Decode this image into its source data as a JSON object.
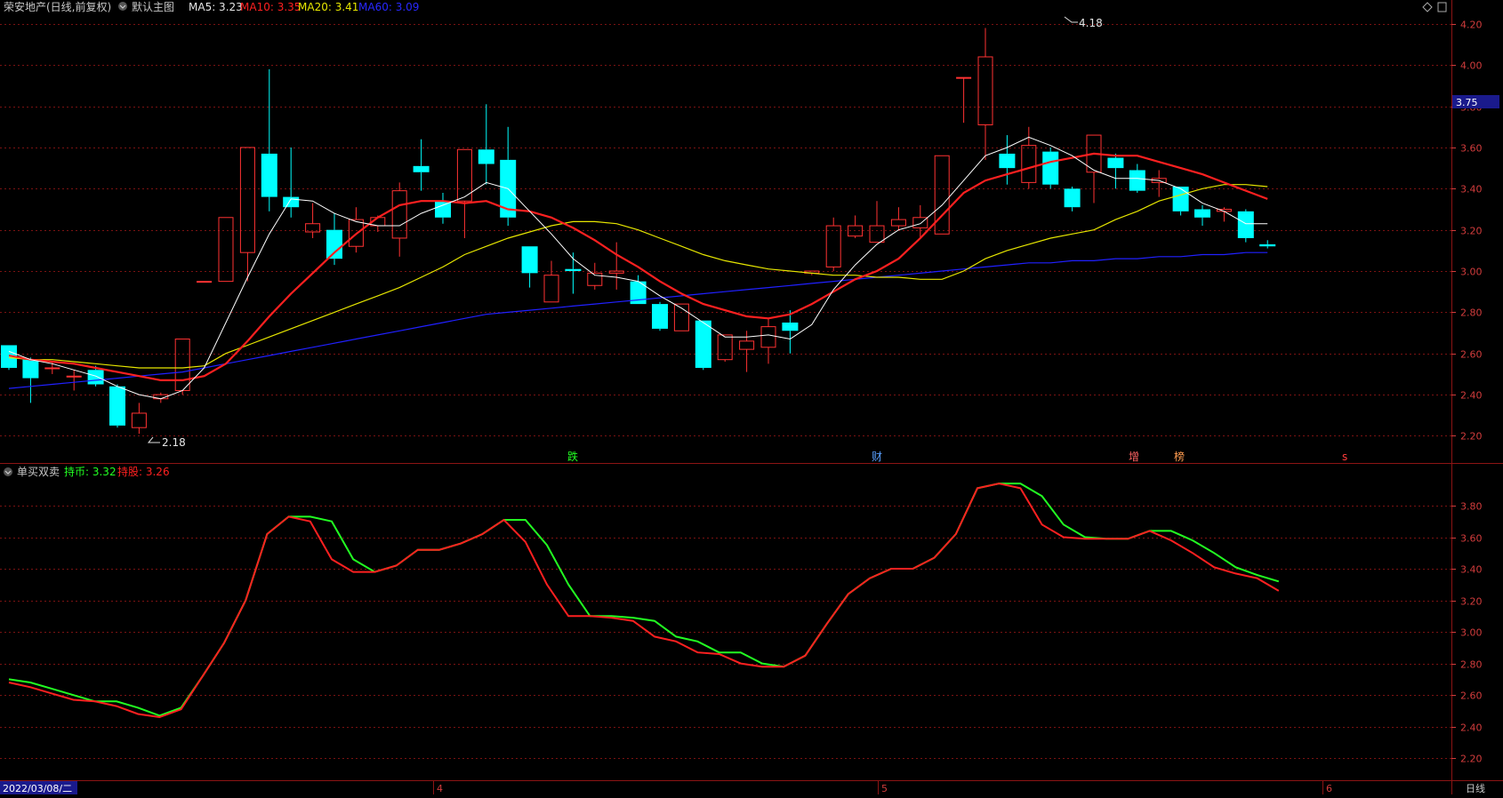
{
  "header": {
    "stock_name": "荣安地产(日线,前复权)",
    "main_indicator": "默认主图",
    "ma5_label": "MA5: 3.23",
    "ma10_label": "MA10: 3.35",
    "ma20_label": "MA20: 3.41",
    "ma60_label": "MA60: 3.09"
  },
  "sub_header": {
    "indicator_name": "单买双卖",
    "hold_coin_label": "持币: 3.32",
    "hold_stock_label": "持股: 3.26"
  },
  "price_badge": "3.75",
  "annotations": {
    "high_label": "4.18",
    "low_label": "2.18",
    "event_die": "跌",
    "event_cai": "财",
    "event_zeng": "增",
    "event_bang": "榜",
    "event_s": "s"
  },
  "bottom_bar": {
    "date_label": "2022/03/08/二",
    "month_4": "4",
    "month_5": "5",
    "month_6": "6",
    "period_label": "日线"
  },
  "colors": {
    "background": "#000000",
    "grid": "#7a1212",
    "up": "#ff3232",
    "down": "#00ffff",
    "ma5": "#ffffff",
    "ma10": "#ff2020",
    "ma20": "#e6e600",
    "ma60": "#2020ff",
    "hold_coin": "#22ff22",
    "hold_stock": "#ff2020",
    "axis_text": "#d23c3c",
    "badge": "#1a1a8c"
  },
  "chart_data": [
    {
      "type": "candlestick",
      "y_ticks": [
        2.2,
        2.4,
        2.6,
        2.8,
        3.0,
        3.2,
        3.4,
        3.6,
        3.8,
        4.0,
        4.2
      ],
      "ylim": [
        2.12,
        4.26
      ],
      "grid": true,
      "candles": [
        [
          2.64,
          2.53,
          2.64,
          2.52
        ],
        [
          2.57,
          2.48,
          2.58,
          2.36
        ],
        [
          2.53,
          2.53,
          2.56,
          2.5
        ],
        [
          2.49,
          2.49,
          2.52,
          2.42
        ],
        [
          2.52,
          2.45,
          2.54,
          2.44
        ],
        [
          2.44,
          2.25,
          2.45,
          2.24
        ],
        [
          2.24,
          2.31,
          2.36,
          2.21
        ],
        [
          2.38,
          2.4,
          2.41,
          2.36
        ],
        [
          2.42,
          2.67,
          2.67,
          2.4
        ],
        [
          2.95,
          2.95,
          2.95,
          2.95
        ],
        [
          2.95,
          3.26,
          3.26,
          2.95
        ],
        [
          3.09,
          3.6,
          3.6,
          2.95
        ],
        [
          3.57,
          3.36,
          3.98,
          3.29
        ],
        [
          3.36,
          3.31,
          3.6,
          3.26
        ],
        [
          3.19,
          3.23,
          3.33,
          3.16
        ],
        [
          3.2,
          3.06,
          3.28,
          3.03
        ],
        [
          3.12,
          3.25,
          3.31,
          3.09
        ],
        [
          3.22,
          3.26,
          3.27,
          3.19
        ],
        [
          3.16,
          3.39,
          3.43,
          3.07
        ],
        [
          3.51,
          3.48,
          3.64,
          3.39
        ],
        [
          3.34,
          3.26,
          3.38,
          3.23
        ],
        [
          3.34,
          3.59,
          3.59,
          3.16
        ],
        [
          3.59,
          3.52,
          3.81,
          3.42
        ],
        [
          3.54,
          3.26,
          3.7,
          3.22
        ],
        [
          3.12,
          2.99,
          3.12,
          2.92
        ],
        [
          2.85,
          2.98,
          3.05,
          2.85
        ],
        [
          3.01,
          3.0,
          3.09,
          2.89
        ],
        [
          2.93,
          2.99,
          3.04,
          2.91
        ],
        [
          2.99,
          3.0,
          3.14,
          2.91
        ],
        [
          2.95,
          2.84,
          2.98,
          2.84
        ],
        [
          2.84,
          2.72,
          2.85,
          2.71
        ],
        [
          2.71,
          2.84,
          2.84,
          2.71
        ],
        [
          2.76,
          2.53,
          2.76,
          2.52
        ],
        [
          2.57,
          2.69,
          2.69,
          2.56
        ],
        [
          2.62,
          2.66,
          2.71,
          2.51
        ],
        [
          2.63,
          2.73,
          2.77,
          2.55
        ],
        [
          2.75,
          2.71,
          2.81,
          2.6
        ],
        [
          2.99,
          3.0,
          3.0,
          2.98
        ],
        [
          3.02,
          3.22,
          3.26,
          3.0
        ],
        [
          3.17,
          3.22,
          3.27,
          3.16
        ],
        [
          3.14,
          3.22,
          3.34,
          3.14
        ],
        [
          3.22,
          3.25,
          3.31,
          3.2
        ],
        [
          3.21,
          3.26,
          3.32,
          3.16
        ],
        [
          3.18,
          3.56,
          3.56,
          3.18
        ],
        [
          3.94,
          3.94,
          3.94,
          3.72
        ],
        [
          3.71,
          4.04,
          4.18,
          3.54
        ],
        [
          3.57,
          3.5,
          3.66,
          3.42
        ],
        [
          3.43,
          3.61,
          3.7,
          3.4
        ],
        [
          3.58,
          3.42,
          3.6,
          3.4
        ],
        [
          3.4,
          3.31,
          3.41,
          3.29
        ],
        [
          3.48,
          3.66,
          3.66,
          3.33
        ],
        [
          3.55,
          3.5,
          3.57,
          3.4
        ],
        [
          3.49,
          3.39,
          3.52,
          3.38
        ],
        [
          3.43,
          3.45,
          3.49,
          3.36
        ],
        [
          3.41,
          3.29,
          3.41,
          3.27
        ],
        [
          3.3,
          3.26,
          3.32,
          3.22
        ],
        [
          3.29,
          3.3,
          3.31,
          3.24
        ],
        [
          3.29,
          3.16,
          3.3,
          3.14
        ],
        [
          3.13,
          3.12,
          3.15,
          3.11
        ]
      ],
      "ma5": [
        2.61,
        2.57,
        2.55,
        2.52,
        2.49,
        2.44,
        2.4,
        2.38,
        2.42,
        2.53,
        2.75,
        2.97,
        3.18,
        3.35,
        3.34,
        3.28,
        3.24,
        3.22,
        3.22,
        3.28,
        3.32,
        3.36,
        3.43,
        3.4,
        3.29,
        3.18,
        3.06,
        2.98,
        2.97,
        2.95,
        2.88,
        2.82,
        2.75,
        2.68,
        2.68,
        2.69,
        2.67,
        2.74,
        2.91,
        3.03,
        3.13,
        3.2,
        3.23,
        3.32,
        3.44,
        3.56,
        3.6,
        3.65,
        3.61,
        3.56,
        3.49,
        3.45,
        3.45,
        3.44,
        3.4,
        3.33,
        3.29,
        3.23,
        3.23
      ],
      "ma10": [
        2.59,
        2.57,
        2.56,
        2.55,
        2.53,
        2.51,
        2.49,
        2.47,
        2.47,
        2.49,
        2.55,
        2.66,
        2.78,
        2.89,
        2.99,
        3.09,
        3.18,
        3.26,
        3.32,
        3.34,
        3.34,
        3.33,
        3.34,
        3.3,
        3.29,
        3.26,
        3.21,
        3.15,
        3.08,
        3.02,
        2.95,
        2.89,
        2.84,
        2.81,
        2.78,
        2.77,
        2.79,
        2.84,
        2.9,
        2.96,
        3.0,
        3.06,
        3.16,
        3.27,
        3.38,
        3.44,
        3.47,
        3.5,
        3.53,
        3.55,
        3.57,
        3.56,
        3.56,
        3.53,
        3.5,
        3.47,
        3.43,
        3.39,
        3.35
      ],
      "ma20": [
        2.58,
        2.57,
        2.57,
        2.56,
        2.55,
        2.54,
        2.53,
        2.53,
        2.53,
        2.54,
        2.6,
        2.64,
        2.68,
        2.72,
        2.76,
        2.8,
        2.84,
        2.88,
        2.92,
        2.97,
        3.02,
        3.08,
        3.12,
        3.16,
        3.19,
        3.22,
        3.24,
        3.24,
        3.23,
        3.2,
        3.16,
        3.12,
        3.08,
        3.05,
        3.03,
        3.01,
        3.0,
        2.99,
        2.98,
        2.98,
        2.97,
        2.97,
        2.96,
        2.96,
        3.0,
        3.06,
        3.1,
        3.13,
        3.16,
        3.18,
        3.2,
        3.25,
        3.29,
        3.34,
        3.37,
        3.4,
        3.42,
        3.42,
        3.41
      ],
      "ma60": [
        2.43,
        2.44,
        2.45,
        2.46,
        2.47,
        2.48,
        2.49,
        2.5,
        2.51,
        2.53,
        2.55,
        2.57,
        2.59,
        2.61,
        2.63,
        2.65,
        2.67,
        2.69,
        2.71,
        2.73,
        2.75,
        2.77,
        2.79,
        2.8,
        2.81,
        2.82,
        2.83,
        2.84,
        2.85,
        2.86,
        2.87,
        2.88,
        2.89,
        2.9,
        2.91,
        2.92,
        2.93,
        2.94,
        2.95,
        2.96,
        2.97,
        2.98,
        2.99,
        3.0,
        3.01,
        3.02,
        3.03,
        3.04,
        3.04,
        3.05,
        3.05,
        3.06,
        3.06,
        3.07,
        3.07,
        3.08,
        3.08,
        3.09,
        3.09
      ]
    },
    {
      "type": "line",
      "y_ticks": [
        2.2,
        2.4,
        2.6,
        2.8,
        3.0,
        3.2,
        3.4,
        3.6,
        3.8
      ],
      "ylim": [
        2.1,
        3.98
      ],
      "grid": true,
      "series": [
        {
          "name": "持币",
          "values": [
            2.7,
            2.68,
            2.64,
            2.6,
            2.56,
            2.56,
            2.52,
            2.47,
            2.52,
            2.72,
            2.93,
            3.2,
            3.62,
            3.73,
            3.73,
            3.7,
            3.46,
            3.38,
            3.42,
            3.52,
            3.52,
            3.56,
            3.62,
            3.71,
            3.71,
            3.55,
            3.3,
            3.1,
            3.1,
            3.09,
            3.07,
            2.97,
            2.94,
            2.87,
            2.87,
            2.8,
            2.78,
            2.85,
            3.05,
            3.24,
            3.34,
            3.4,
            3.4,
            3.47,
            3.62,
            3.91,
            3.94,
            3.94,
            3.86,
            3.68,
            3.6,
            3.59,
            3.59,
            3.64,
            3.64,
            3.58,
            3.5,
            3.41,
            3.36,
            3.32
          ]
        },
        {
          "name": "持股",
          "values": [
            2.68,
            2.65,
            2.61,
            2.57,
            2.56,
            2.53,
            2.48,
            2.46,
            2.51,
            2.72,
            2.93,
            3.2,
            3.62,
            3.73,
            3.7,
            3.46,
            3.38,
            3.38,
            3.42,
            3.52,
            3.52,
            3.56,
            3.62,
            3.71,
            3.57,
            3.3,
            3.1,
            3.1,
            3.09,
            3.07,
            2.97,
            2.94,
            2.87,
            2.86,
            2.8,
            2.78,
            2.78,
            2.85,
            3.05,
            3.24,
            3.34,
            3.4,
            3.4,
            3.47,
            3.62,
            3.91,
            3.94,
            3.91,
            3.68,
            3.6,
            3.59,
            3.59,
            3.59,
            3.64,
            3.58,
            3.5,
            3.41,
            3.37,
            3.34,
            3.26
          ]
        }
      ]
    }
  ]
}
